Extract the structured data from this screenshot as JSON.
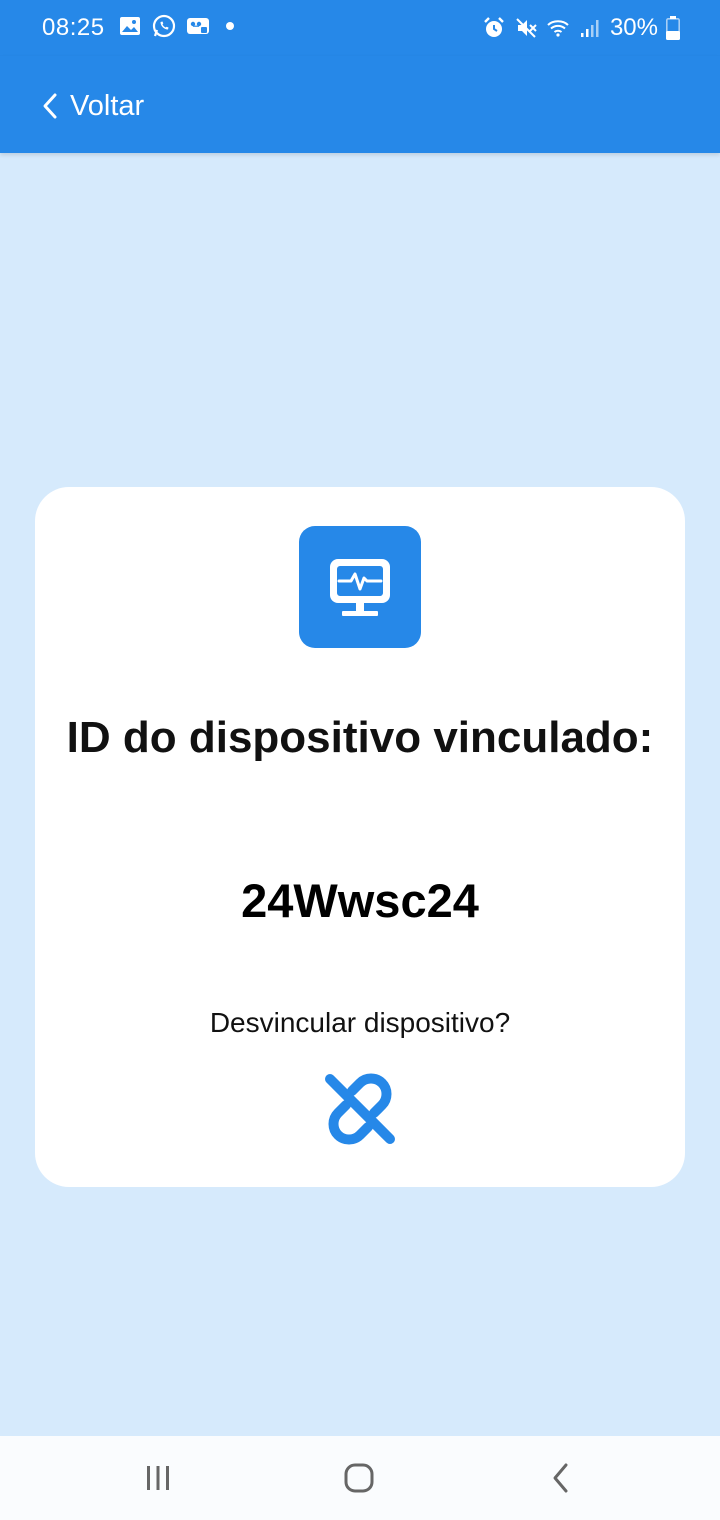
{
  "status_bar": {
    "time": "08:25",
    "battery": "30%"
  },
  "app_bar": {
    "back_label": "Voltar"
  },
  "card": {
    "title": "ID do dispositivo vinculado:",
    "device_id": "24Wwsc24",
    "unlink_question": "Desvincular dispositivo?",
    "icon_badge": "monitor-heartbeat-icon",
    "unlink_icon": "link-off-icon"
  },
  "colors": {
    "primary": "#2688e8",
    "background": "#d6eafc",
    "card": "#ffffff"
  },
  "nav_bar": {
    "recents_icon": "recents-icon",
    "home_icon": "home-icon",
    "back_icon": "back-icon"
  }
}
